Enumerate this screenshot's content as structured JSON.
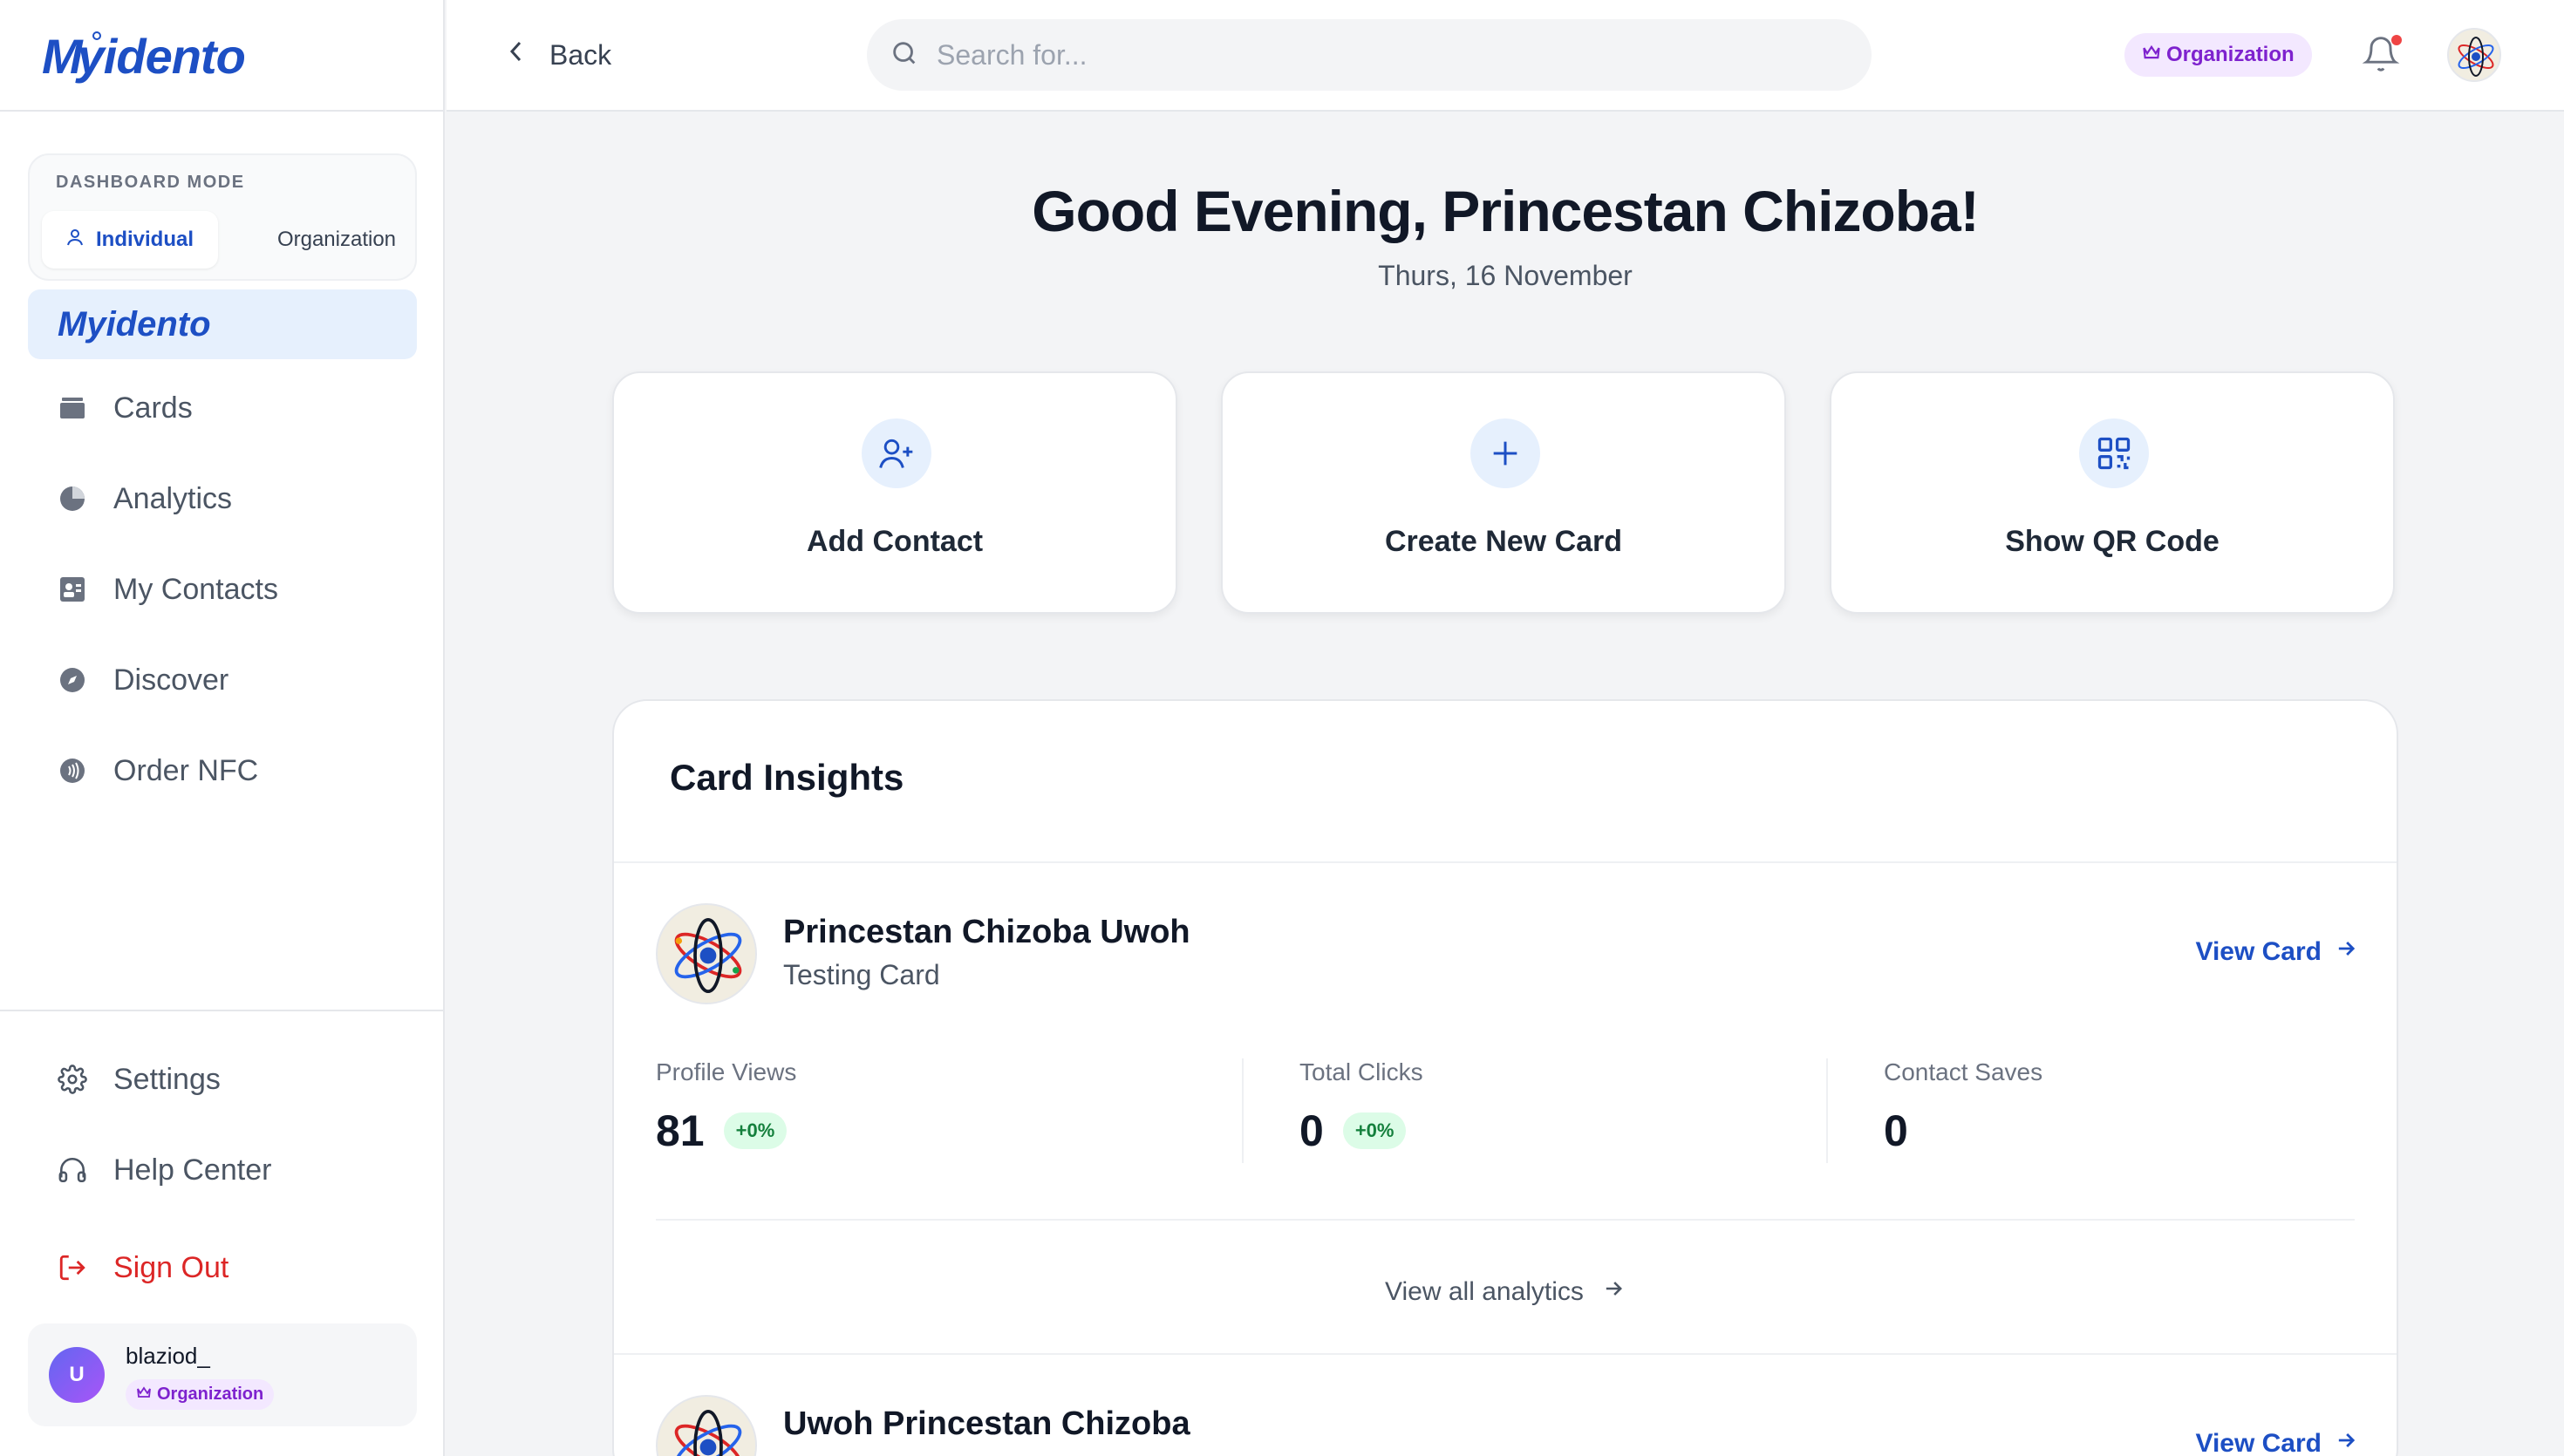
{
  "app": {
    "logo_text": "Myidento",
    "logo_m": "M",
    "logo_rest": "yidento"
  },
  "sidebar": {
    "mode_title": "DASHBOARD MODE",
    "mode_individual": "Individual",
    "mode_organization": "Organization",
    "brand_item": "Myidento",
    "nav": [
      {
        "label": "Cards",
        "icon": "cards-icon"
      },
      {
        "label": "Analytics",
        "icon": "pie-chart-icon"
      },
      {
        "label": "My Contacts",
        "icon": "contacts-icon"
      },
      {
        "label": "Discover",
        "icon": "compass-icon"
      },
      {
        "label": "Order NFC",
        "icon": "nfc-icon"
      }
    ],
    "bottom": [
      {
        "label": "Settings",
        "icon": "gear-icon"
      },
      {
        "label": "Help Center",
        "icon": "headset-icon"
      },
      {
        "label": "Sign Out",
        "icon": "sign-out-icon"
      }
    ],
    "user": {
      "initial": "U",
      "name": "blaziod_",
      "badge": "Organization"
    }
  },
  "topbar": {
    "back_label": "Back",
    "search_placeholder": "Search for...",
    "org_badge": "Organization"
  },
  "main": {
    "greeting": "Good Evening, Princestan Chizoba!",
    "date": "Thurs, 16 November",
    "actions": [
      {
        "label": "Add Contact",
        "icon": "user-plus-icon"
      },
      {
        "label": "Create New Card",
        "icon": "plus-icon"
      },
      {
        "label": "Show QR Code",
        "icon": "qr-code-icon"
      }
    ],
    "insights": {
      "title": "Card Insights",
      "view_card_label": "View Card",
      "view_all_label": "View all analytics",
      "cards": [
        {
          "name": "Princestan Chizoba Uwoh",
          "subtitle": "Testing Card",
          "stats": [
            {
              "label": "Profile Views",
              "value": "81",
              "change": "+0%"
            },
            {
              "label": "Total Clicks",
              "value": "0",
              "change": "+0%"
            },
            {
              "label": "Contact Saves",
              "value": "0",
              "change": ""
            }
          ]
        },
        {
          "name": "Uwoh Princestan Chizoba"
        }
      ]
    }
  },
  "colors": {
    "accent": "#1d4fc4",
    "accent_light": "#e6f0fd",
    "danger": "#dc2626",
    "badge_purple": "#7e22ce",
    "positive": "#15803d"
  }
}
